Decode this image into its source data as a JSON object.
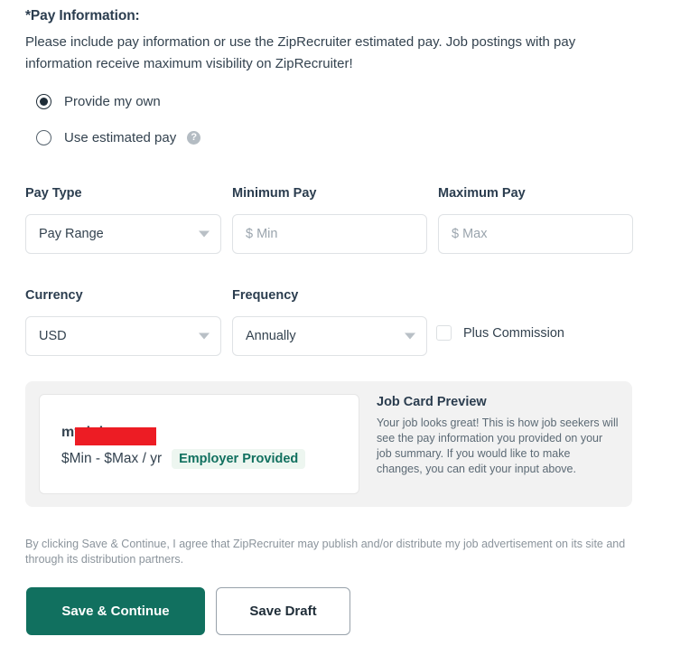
{
  "section": {
    "title": "*Pay Information:",
    "description": "Please include pay information or use the ZipRecruiter estimated pay. Job postings with pay information receive maximum visibility on ZipRecruiter!"
  },
  "pay_source": {
    "options": [
      {
        "label": "Provide my own",
        "selected": true
      },
      {
        "label": "Use estimated pay",
        "selected": false,
        "help_icon": "help-circle-icon",
        "help_glyph": "?"
      }
    ]
  },
  "fields": {
    "pay_type": {
      "label": "Pay Type",
      "value": "Pay Range",
      "type": "select"
    },
    "minimum_pay": {
      "label": "Minimum Pay",
      "value": "",
      "placeholder": "$ Min",
      "type": "text"
    },
    "maximum_pay": {
      "label": "Maximum Pay",
      "value": "",
      "placeholder": "$ Max",
      "type": "text"
    },
    "currency": {
      "label": "Currency",
      "value": "USD",
      "type": "select"
    },
    "frequency": {
      "label": "Frequency",
      "value": "Annually",
      "type": "select"
    },
    "plus_commission": {
      "label": "Plus Commission",
      "checked": false
    }
  },
  "preview": {
    "job_title": "my job",
    "pay_range": "$Min - $Max / yr",
    "badge": "Employer Provided",
    "heading": "Job Card Preview",
    "body": "Your job looks great! This is how job seekers will see the pay information you provided on your job summary. If you would like to make changes, you can edit your input above."
  },
  "footer": {
    "disclaimer": "By clicking Save & Continue, I agree that ZipRecruiter may publish and/or distribute my job advertisement on its site and through its distribution partners.",
    "save_continue_label": "Save & Continue",
    "save_draft_label": "Save Draft"
  },
  "colors": {
    "brand_teal": "#11705f",
    "text_dark": "#2b3d4f",
    "muted": "#8b949c",
    "badge_bg": "#edf6f0",
    "redaction": "#ed1c24",
    "panel_bg": "#f2f2f2"
  }
}
